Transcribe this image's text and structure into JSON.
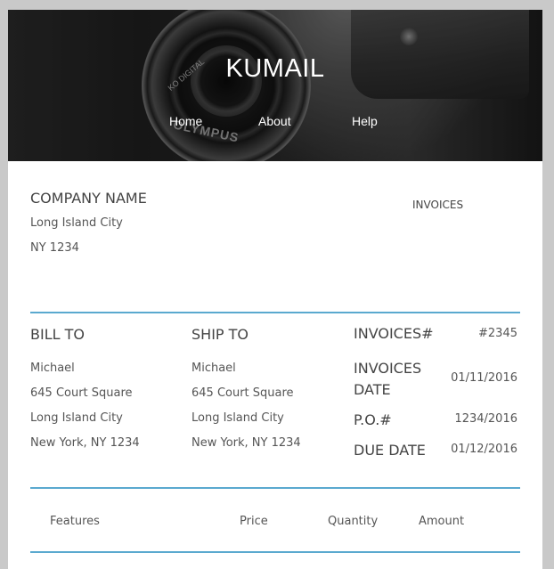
{
  "header": {
    "title": "KUMAIL",
    "nav": [
      "Home",
      "About",
      "Help"
    ],
    "lens_text": "KO DIGITAL",
    "brand_text": "OLYMPUS"
  },
  "company": {
    "name": "COMPANY NAME",
    "city": "Long Island City",
    "state_zip": "NY 1234",
    "invoices_label": "INVOICES"
  },
  "bill_to": {
    "heading": "BILL TO",
    "name": "Michael",
    "street": "645 Court Square",
    "city": "Long Island City",
    "state": "New York, NY 1234"
  },
  "ship_to": {
    "heading": "SHIP TO",
    "name": "Michael",
    "street": "645 Court Square",
    "city": "Long Island City",
    "state": "New York, NY 1234"
  },
  "invoice_meta": {
    "number_label": "INVOICES#",
    "number_value": "#2345",
    "date_label_1": "INVOICES",
    "date_label_2": "DATE",
    "date_value": "01/11/2016",
    "po_label": "P.O.#",
    "po_value": "1234/2016",
    "due_label": "DUE DATE",
    "due_value": "01/12/2016"
  },
  "table": {
    "columns": [
      "Features",
      "Price",
      "Quantity",
      "Amount"
    ]
  },
  "colors": {
    "accent_line": "#5aa9cf",
    "background": "#c9c9c9"
  }
}
